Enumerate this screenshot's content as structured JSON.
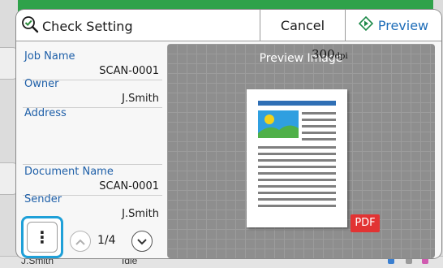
{
  "background_app": {
    "bottom_text_left": "J.Smith",
    "bottom_text_mid": "Idle"
  },
  "dialog": {
    "title": "Check Setting",
    "cancel_label": "Cancel",
    "preview_label": "Preview"
  },
  "fields": [
    {
      "label": "Job Name",
      "value": "SCAN-0001"
    },
    {
      "label": "Owner",
      "value": "J.Smith"
    },
    {
      "label": "Address",
      "value": ""
    },
    {
      "label": "Document Name",
      "value": "SCAN-0001"
    },
    {
      "label": "Sender",
      "value": "J.Smith"
    }
  ],
  "preview": {
    "title": "Preview Image",
    "dpi_value": "300",
    "dpi_unit": "dpi",
    "format_badge": "PDF"
  },
  "pagination": {
    "indicator": "1/4"
  },
  "menu_button": {
    "glyph": "⋮"
  },
  "colors": {
    "accent_blue": "#1e5fa8",
    "preview_blue": "#1e6db8",
    "highlight_cyan": "#1fa0d8",
    "pdf_red": "#e23333"
  }
}
